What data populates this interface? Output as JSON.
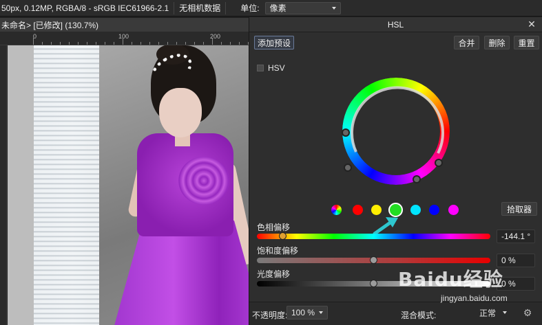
{
  "topbar": {
    "doc_info": "50px, 0.12MP, RGBA/8 - sRGB IEC61966-2.1",
    "camera": "无相机数据",
    "unit_label": "单位:",
    "unit_value": "像素"
  },
  "document": {
    "tab_title": "未命名> [已修改] (130.7%)",
    "ruler_marks": [
      "0",
      "100",
      "200"
    ]
  },
  "panel": {
    "title": "HSL",
    "close_icon": "close-icon",
    "add_preset": "添加预设",
    "merge": "合并",
    "delete": "删除",
    "reset": "重置",
    "hsv_label": "HSV",
    "picker": "拾取器",
    "swatches": [
      {
        "name": "master",
        "color": "multi"
      },
      {
        "name": "red",
        "color": "#ff0000"
      },
      {
        "name": "yellow",
        "color": "#ffee00"
      },
      {
        "name": "green",
        "color": "#22dd22",
        "active": true
      },
      {
        "name": "cyan",
        "color": "#00e5ff"
      },
      {
        "name": "blue",
        "color": "#0000ff"
      },
      {
        "name": "magenta",
        "color": "#ff00ff"
      }
    ],
    "hue": {
      "label": "色相偏移",
      "value": "-144.1 °",
      "fraction": 0.11
    },
    "saturation": {
      "label": "饱和度偏移",
      "value": "0 %",
      "fraction": 0.5
    },
    "luminosity": {
      "label": "光度偏移",
      "value": "0 %",
      "fraction": 0.5
    },
    "opacity_label": "不透明度:",
    "opacity_value": "100 %",
    "blend_label": "混合模式:",
    "blend_value": "正常"
  },
  "watermark": {
    "brand": "Baidu经验",
    "url": "jingyan.baidu.com"
  }
}
